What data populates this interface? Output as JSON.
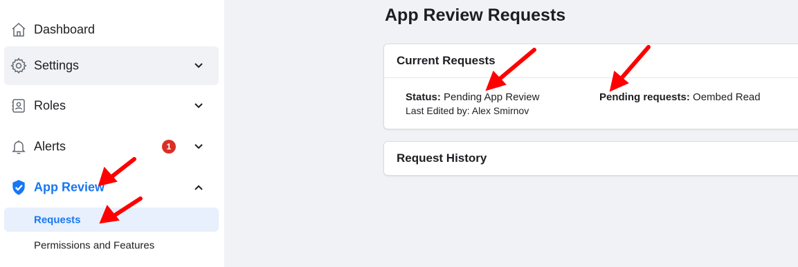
{
  "sidebar": {
    "items": [
      {
        "label": "Dashboard",
        "icon": "home-icon"
      },
      {
        "label": "Settings",
        "icon": "gear-icon"
      },
      {
        "label": "Roles",
        "icon": "id-badge-icon"
      },
      {
        "label": "Alerts",
        "icon": "bell-icon",
        "badge": "1"
      },
      {
        "label": "App Review",
        "icon": "shield-check-icon"
      }
    ],
    "subitems": [
      {
        "label": "Requests"
      },
      {
        "label": "Permissions and Features"
      }
    ]
  },
  "main": {
    "title": "App Review Requests",
    "current_requests": {
      "title": "Current Requests",
      "status_label": "Status:",
      "status_value": "Pending App Review",
      "edited_by": "Last Edited by: Alex Smirnov",
      "pending_label": "Pending requests:",
      "pending_value": "Oembed Read"
    },
    "request_history": {
      "title": "Request History"
    }
  },
  "colors": {
    "accent": "#1877f2",
    "badge": "#d93025",
    "annotation_arrow": "#ff0000",
    "background": "#f0f2f5"
  }
}
